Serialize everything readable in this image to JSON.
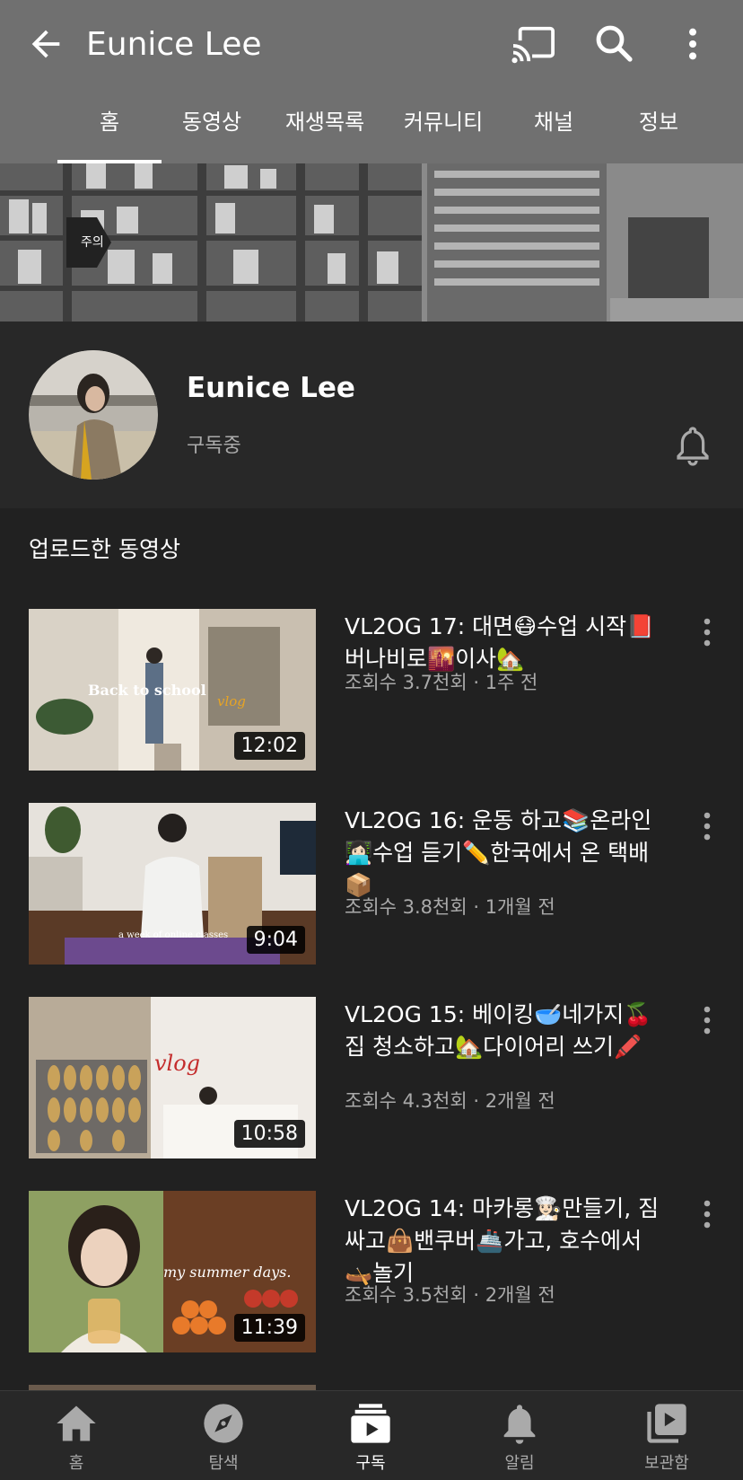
{
  "appbar": {
    "title": "Eunice Lee",
    "back_icon": "arrow-back-icon",
    "cast_icon": "cast-icon",
    "search_icon": "search-icon",
    "more_icon": "more-vert-icon",
    "bg_color": "#707070"
  },
  "tabs": [
    {
      "label": "홈",
      "active": true
    },
    {
      "label": "동영상"
    },
    {
      "label": "재생목록"
    },
    {
      "label": "커뮤니티"
    },
    {
      "label": "채널"
    },
    {
      "label": "정보"
    }
  ],
  "channel": {
    "name": "Eunice Lee",
    "subscription_status": "구독중",
    "bell_icon": "notification-bell-icon"
  },
  "section": {
    "title": "업로드한 동영상"
  },
  "videos": [
    {
      "title": "VL2OG 17: 대면😷수업 시작📕 버나비로🌇이사🏡",
      "meta": "조회수 3.7천회 · 1주 전",
      "duration": "12:02",
      "thumb_caption": "Back to school"
    },
    {
      "title": "VL2OG 16: 운동 하고📚온라인👩🏻‍💻수업 듣기✏️한국에서 온 택배📦",
      "meta": "조회수 3.8천회 · 1개월 전",
      "duration": "9:04",
      "thumb_caption": "a week of online classes"
    },
    {
      "title": "VL2OG 15: 베이킹🥣네가지🍒 집 청소하고🏡다이어리 쓰기🖍️",
      "meta": "조회수 4.3천회 · 2개월 전",
      "duration": "10:58",
      "thumb_caption": "vlog"
    },
    {
      "title": "VL2OG 14: 마카롱👩🏻‍🍳만들기, 짐싸고👜밴쿠버🚢가고, 호수에서🛶놀기",
      "meta": "조회수 3.5천회 · 2개월 전",
      "duration": "11:39",
      "thumb_caption": "my summer days."
    }
  ],
  "bottom_nav": [
    {
      "label": "홈",
      "icon": "home-icon"
    },
    {
      "label": "탐색",
      "icon": "explore-icon"
    },
    {
      "label": "구독",
      "icon": "subscriptions-icon",
      "active": true
    },
    {
      "label": "알림",
      "icon": "notifications-icon"
    },
    {
      "label": "보관함",
      "icon": "library-icon"
    }
  ]
}
